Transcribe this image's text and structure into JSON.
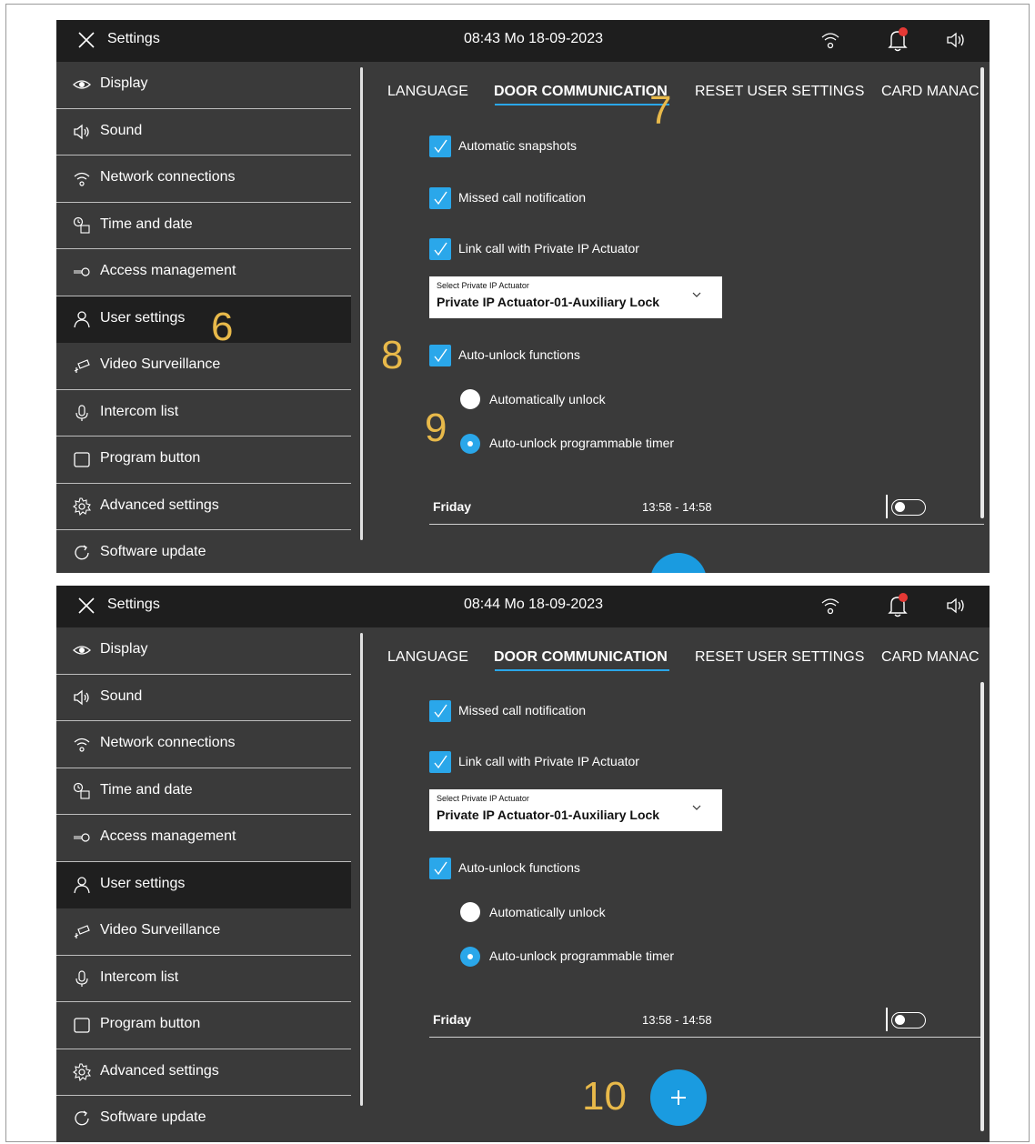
{
  "panels": [
    {
      "title": "Settings",
      "clock": "08:43 Mo 18-09-2023",
      "sidebar": [
        "Display",
        "Sound",
        "Network connections",
        "Time and date",
        "Access  management",
        "User settings",
        "Video Surveillance",
        "Intercom list",
        "Program button",
        "Advanced settings",
        "Software update"
      ],
      "active_index": 5,
      "tabs": [
        "LANGUAGE",
        "DOOR COMMUNICATION",
        "RESET USER SETTINGS",
        "CARD MANAC"
      ],
      "checks": [
        "Automatic snapshots",
        "Missed call notification",
        "Link call with Private  IP Actuator"
      ],
      "select_caption": "Select Private IP Actuator",
      "select_value": "Private IP Actuator-01-Auxiliary Lock",
      "auto_unlock": "Auto-unlock functions",
      "radio_1": "Automatically unlock",
      "radio_2": "Auto-unlock programmable timer",
      "sched_day": "Friday",
      "sched_time": "13:58 - 14:58",
      "callouts": [
        "6",
        "7",
        "8",
        "9"
      ]
    },
    {
      "title": "Settings",
      "clock": "08:44 Mo 18-09-2023",
      "sidebar": [
        "Display",
        "Sound",
        "Network connections",
        "Time and date",
        "Access  management",
        "User settings",
        "Video Surveillance",
        "Intercom list",
        "Program button",
        "Advanced settings",
        "Software update"
      ],
      "active_index": 5,
      "tabs": [
        "LANGUAGE",
        "DOOR COMMUNICATION",
        "RESET USER SETTINGS",
        "CARD MANAC"
      ],
      "checks": [
        "Missed call notification",
        "Link call with Private  IP Actuator"
      ],
      "select_caption": "Select Private IP Actuator",
      "select_value": "Private IP Actuator-01-Auxiliary Lock",
      "auto_unlock": "Auto-unlock functions",
      "radio_1": "Automatically unlock",
      "radio_2": "Auto-unlock programmable timer",
      "sched_day": "Friday",
      "sched_time": "13:58 - 14:58",
      "callouts": [
        "10"
      ]
    }
  ],
  "colors": {
    "accent": "#2aa7ea",
    "callout": "#e8b94a",
    "bar": "#1e1e1e",
    "panel": "#3a3a3a"
  }
}
